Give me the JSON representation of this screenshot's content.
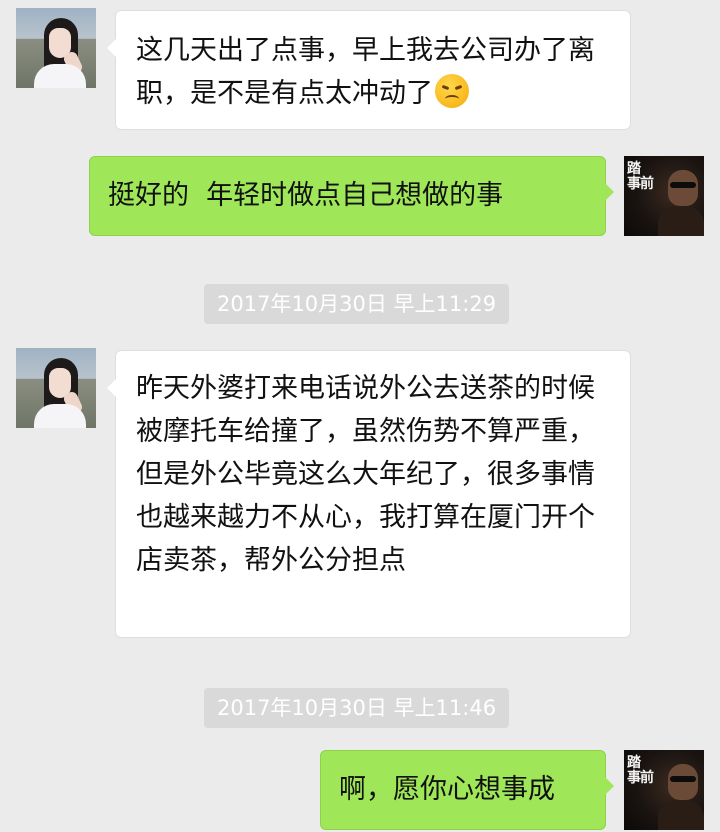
{
  "chat": {
    "messages": [
      {
        "side": "in",
        "avatar": "girl-avatar",
        "text": "这几天出了点事，早上我去公司办了离职，是不是有点太冲动了",
        "emoji": "confounded-face-emoji"
      },
      {
        "side": "out",
        "avatar": "man-avatar",
        "text": "挺好的  年轻时做点自己想做的事"
      },
      {
        "type": "timestamp",
        "text": "2017年10月30日 早上11:29"
      },
      {
        "side": "in",
        "avatar": "girl-avatar",
        "text": "昨天外婆打来电话说外公去送茶的时候被摩托车给撞了，虽然伤势不算严重，但是外公毕竟这么大年纪了，很多事情也越来越力不从心，我打算在厦门开个店卖茶，帮外公分担点"
      },
      {
        "type": "timestamp",
        "text": "2017年10月30日 早上11:46"
      },
      {
        "side": "out",
        "avatar": "man-avatar",
        "text": "啊，愿你心想事成"
      }
    ]
  },
  "avatar_man_glyph": "踏\n事前",
  "colors": {
    "background": "#ebebeb",
    "incoming_bubble": "#ffffff",
    "outgoing_bubble": "#9fe658",
    "timestamp_bg": "#d9d9d9",
    "timestamp_text": "#ffffff"
  }
}
